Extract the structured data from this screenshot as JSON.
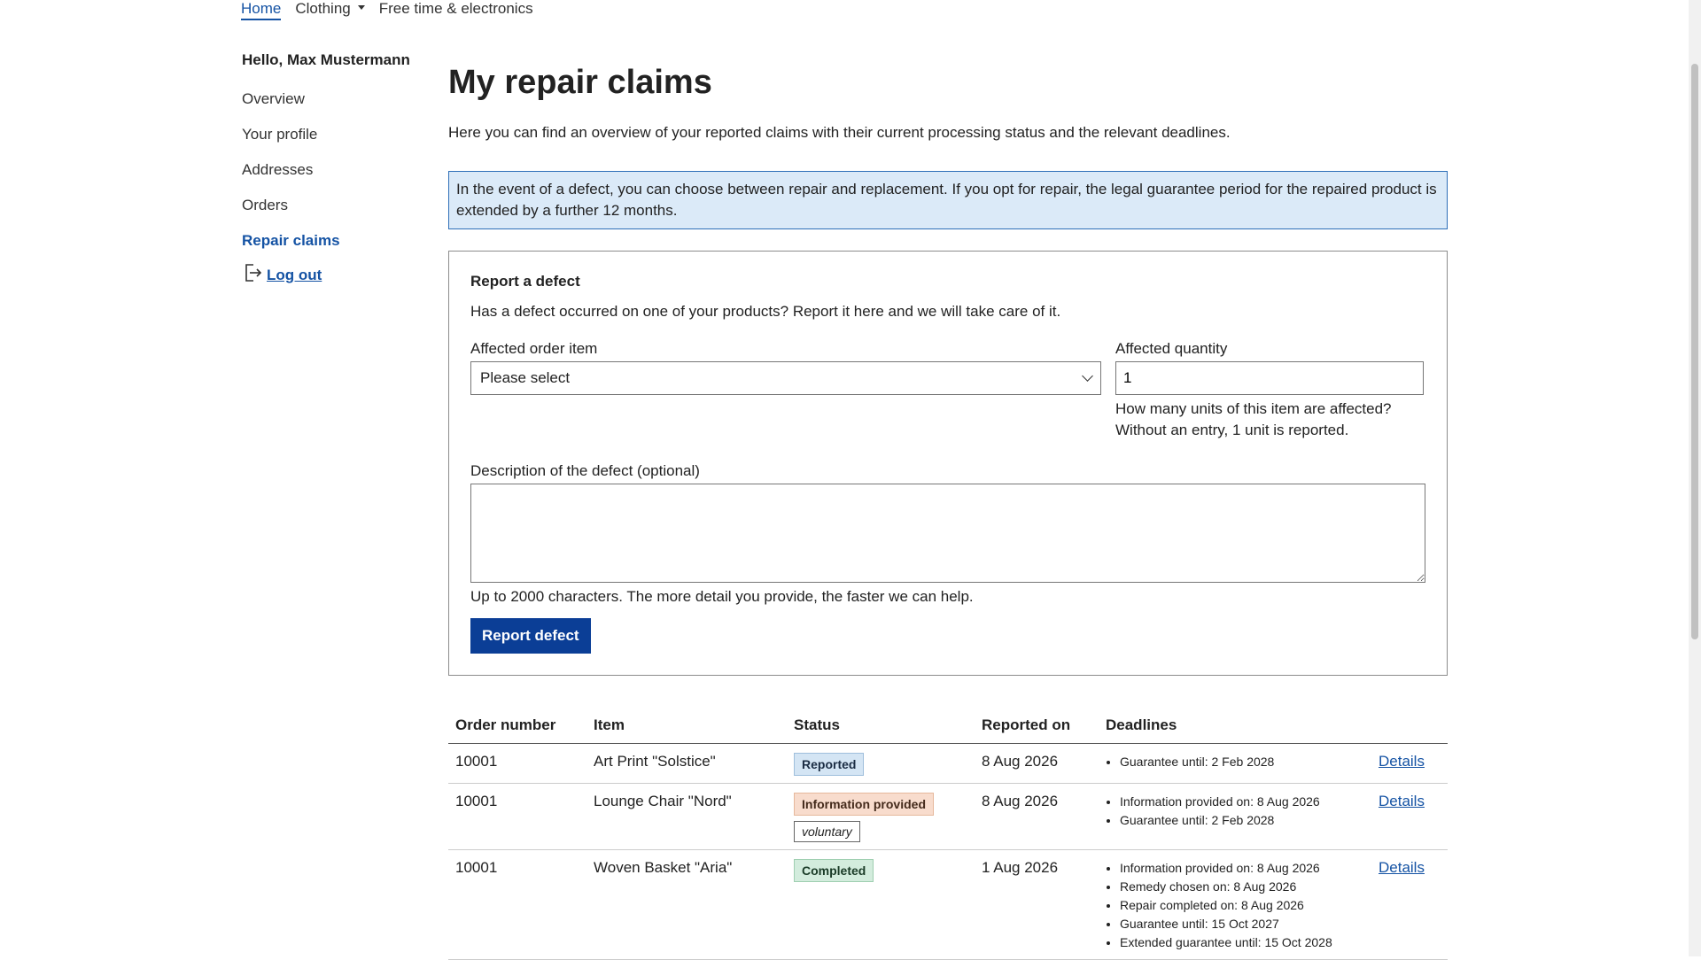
{
  "topnav": {
    "items": [
      {
        "label": "Home",
        "active": true
      },
      {
        "label": "Clothing",
        "has_dropdown": true
      },
      {
        "label": "Free time & electronics"
      }
    ]
  },
  "sidebar": {
    "greeting": "Hello, Max Mustermann",
    "items": [
      {
        "label": "Overview"
      },
      {
        "label": "Your profile"
      },
      {
        "label": "Addresses"
      },
      {
        "label": "Orders"
      },
      {
        "label": "Repair claims",
        "active": true
      }
    ],
    "logout_label": "Log out",
    "logout_icon": "logout-icon"
  },
  "main": {
    "title": "My repair claims",
    "intro": "Here you can find an overview of your reported claims with their current processing status and the relevant deadlines.",
    "notice": "In the event of a defect, you can choose between repair and replacement. If you opt for repair, the legal guarantee period for the repaired product is extended by a further 12 months."
  },
  "form": {
    "heading": "Report a defect",
    "description": "Has a defect occurred on one of your products? Report it here and we will take care of it.",
    "order_item_label": "Affected order item",
    "order_item_value": "Please select",
    "quantity_label": "Affected quantity",
    "quantity_value": "1",
    "quantity_hint_line1": "How many units of this item are affected?",
    "quantity_hint_line2": "Without an entry, 1 unit is reported.",
    "desc_label": "Description of the defect (optional)",
    "desc_value": "",
    "desc_hint": "Up to 2000 characters. The more detail you provide, the faster we can help.",
    "submit_label": "Report defect"
  },
  "table": {
    "headers": [
      "Order number",
      "Item",
      "Status",
      "Reported on",
      "Deadlines",
      ""
    ],
    "rows": [
      {
        "order": "10001",
        "item": "Art Print \"Solstice\"",
        "status": "Reported",
        "status_color": "#d4e5f4",
        "reported": "8 Aug 2026",
        "deadlines": [
          "Guarantee until: 2 Feb 2028"
        ],
        "details": "Details"
      },
      {
        "order": "10001",
        "item": "Lounge Chair \"Nord\"",
        "status": "Information provided",
        "status_color": "#f8dccd",
        "status_tag": "voluntary",
        "reported": "8 Aug 2026",
        "deadlines": [
          "Information provided on: 8 Aug 2026",
          "Guarantee until: 2 Feb 2028"
        ],
        "details": "Details"
      },
      {
        "order": "10001",
        "item": "Woven Basket \"Aria\"",
        "status": "Completed",
        "status_color": "#d3ecdd",
        "reported": "1 Aug 2026",
        "deadlines": [
          "Information provided on: 8 Aug 2026",
          "Remedy chosen on: 8 Aug 2026",
          "Repair completed on: 8 Aug 2026",
          "Guarantee until: 15 Oct 2027",
          "Extended guarantee until: 15 Oct 2028"
        ],
        "details": "Details"
      }
    ]
  }
}
